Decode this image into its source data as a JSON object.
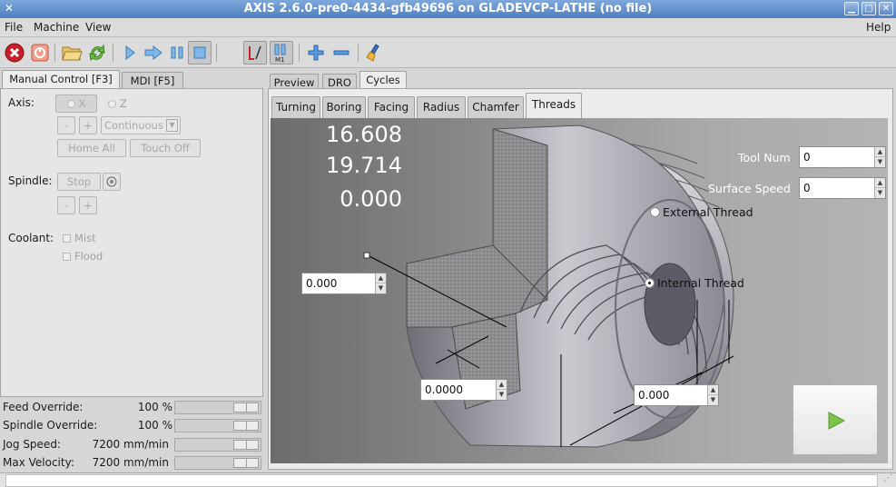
{
  "window": {
    "title": "AXIS 2.6.0-pre0-4434-gfb49696 on GLADEVCP-LATHE (no file)",
    "controls": [
      "minimize",
      "maximize",
      "close"
    ]
  },
  "menubar": {
    "file": "File",
    "machine": "Machine",
    "view": "View",
    "help": "Help"
  },
  "toolbar": {
    "icons": [
      "estop-icon",
      "machine-power-icon",
      "open-file-icon",
      "reload-icon",
      "run-icon",
      "step-icon",
      "pause-icon",
      "stop-icon",
      "block-delete-icon",
      "optional-stop-icon",
      "zoom-in-icon",
      "zoom-out-icon",
      "clear-backplot-icon"
    ],
    "optional_stop_text": "M1"
  },
  "left_tabs": {
    "manual": "Manual Control [F3]",
    "mdi": "MDI [F5]"
  },
  "manual": {
    "axis_label": "Axis:",
    "axis_x": "X",
    "axis_z": "Z",
    "jog_minus": "-",
    "jog_plus": "+",
    "jog_mode": "Continuous",
    "home_all": "Home All",
    "touch_off": "Touch Off",
    "spindle_label": "Spindle:",
    "spindle_stop": "Stop",
    "spindle_minus": "-",
    "spindle_plus": "+",
    "coolant_label": "Coolant:",
    "mist": "Mist",
    "flood": "Flood"
  },
  "overrides": [
    {
      "label": "Feed Override:",
      "value": "100 %",
      "level": 0.75
    },
    {
      "label": "Spindle Override:",
      "value": "100 %",
      "level": 0.75
    },
    {
      "label": "Jog Speed:",
      "value": "7200 mm/min",
      "level": 0.75
    },
    {
      "label": "Max Velocity:",
      "value": "7200 mm/min",
      "level": 0.75
    }
  ],
  "right_tabs": {
    "preview": "Preview",
    "dro": "DRO",
    "cycles": "Cycles"
  },
  "cycle_tabs": {
    "turning": "Turning",
    "boring": "Boring",
    "facing": "Facing",
    "radius": "Radius",
    "chamfer": "Chamfer",
    "threads": "Threads"
  },
  "threads": {
    "dro": [
      "16.608",
      "19.714",
      "0.000"
    ],
    "tool_num_label": "Tool Num",
    "tool_num_value": "0",
    "surface_speed_label": "Surface Speed",
    "surface_speed_value": "0",
    "external_thread": "External Thread",
    "internal_thread": "Internal Thread",
    "internal_selected": true,
    "pitch_value": "0.000",
    "depth_value": "0.0000",
    "length_value": "0.000",
    "go_icon": "play-icon"
  },
  "colors": {
    "title_bar": "#5a87c6",
    "go_arrow": "#7ec24a",
    "estop": "#c8202a"
  }
}
